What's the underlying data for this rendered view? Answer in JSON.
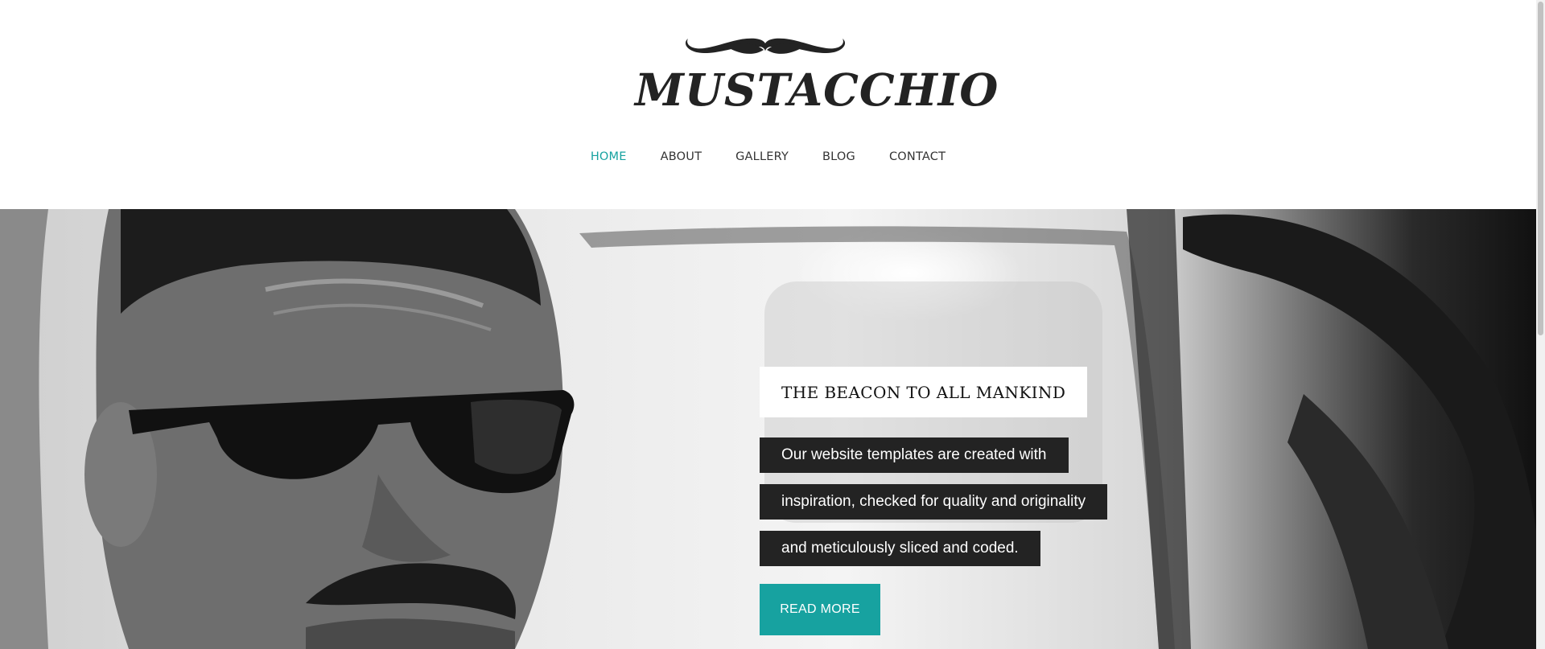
{
  "brand": {
    "logo_text": "MUSTACCHIO",
    "logo_icon": "mustache-icon"
  },
  "nav": {
    "items": [
      {
        "label": "HOME",
        "active": true
      },
      {
        "label": "ABOUT",
        "active": false
      },
      {
        "label": "GALLERY",
        "active": false
      },
      {
        "label": "BLOG",
        "active": false
      },
      {
        "label": "CONTACT",
        "active": false
      }
    ]
  },
  "hero": {
    "title": "THE BEACON TO ALL MANKIND",
    "lines": [
      "Our website templates are created with",
      "inspiration, checked for quality and originality",
      "and meticulously sliced and coded."
    ],
    "button_label": "READ MORE"
  },
  "colors": {
    "accent": "#17a2a0",
    "caption_dark": "#232323",
    "text_dark": "#333333"
  }
}
